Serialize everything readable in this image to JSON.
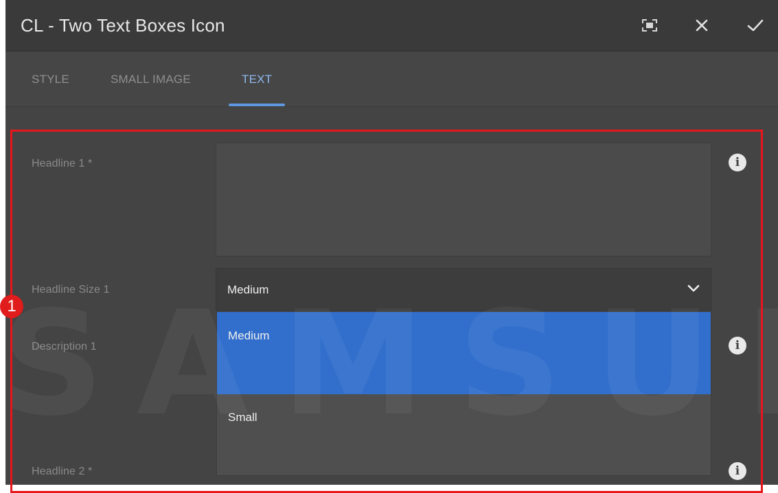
{
  "dialog": {
    "title": "CL - Two Text Boxes Icon",
    "controls": [
      "fullscreen-icon",
      "close-icon",
      "checkmark-icon"
    ]
  },
  "tabs": [
    {
      "label": "STYLE",
      "active": false
    },
    {
      "label": "SMALL IMAGE",
      "active": false
    },
    {
      "label": "TEXT",
      "active": true
    }
  ],
  "form": {
    "headline1_label": "Headline 1 *",
    "headline1_value": "",
    "headline_size1_label": "Headline Size 1",
    "headline_size1_value": "Medium",
    "headline_size1_options": [
      "Medium",
      "Small"
    ],
    "description1_label": "Description 1",
    "headline2_label": "Headline 2 *"
  },
  "annotation": {
    "marker": "1",
    "watermark": "SAMSUNG",
    "frame_color": "#e8161c"
  },
  "colors": {
    "accent": "#5e98e0",
    "selected_option": "#326fcc",
    "panel": "#444444"
  }
}
